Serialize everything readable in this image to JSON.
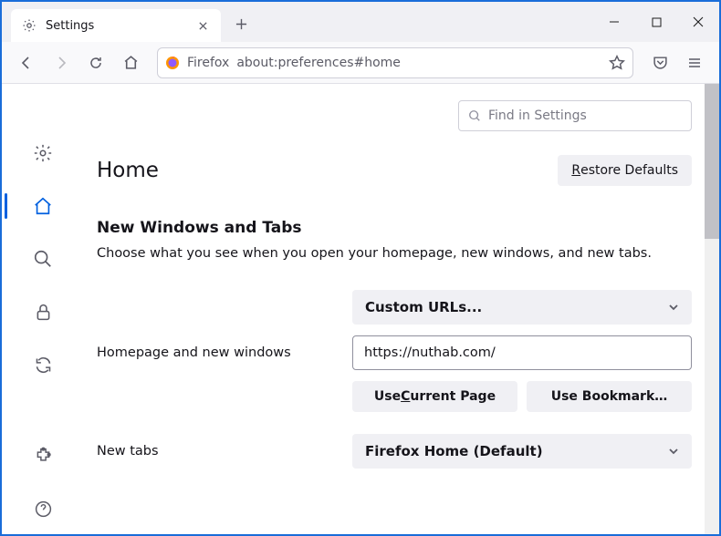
{
  "tab": {
    "title": "Settings"
  },
  "urlbar": {
    "prefix": "Firefox",
    "url": "about:preferences#home"
  },
  "search": {
    "placeholder": "Find in Settings"
  },
  "page": {
    "title": "Home",
    "restore_btn": "estore Defaults",
    "restore_accesskey": "R",
    "section_heading": "New Windows and Tabs",
    "section_desc": "Choose what you see when you open your homepage, new windows, and new tabs."
  },
  "homepage": {
    "label": "Homepage and new windows",
    "select_value": "Custom URLs...",
    "url_value": "https://nuthab.com/",
    "use_current": "urrent Page",
    "use_current_key": "C",
    "use_bookmark": "Use Bookmark…"
  },
  "newtabs": {
    "label": "New tabs",
    "select_value": "Firefox Home (Default)"
  }
}
